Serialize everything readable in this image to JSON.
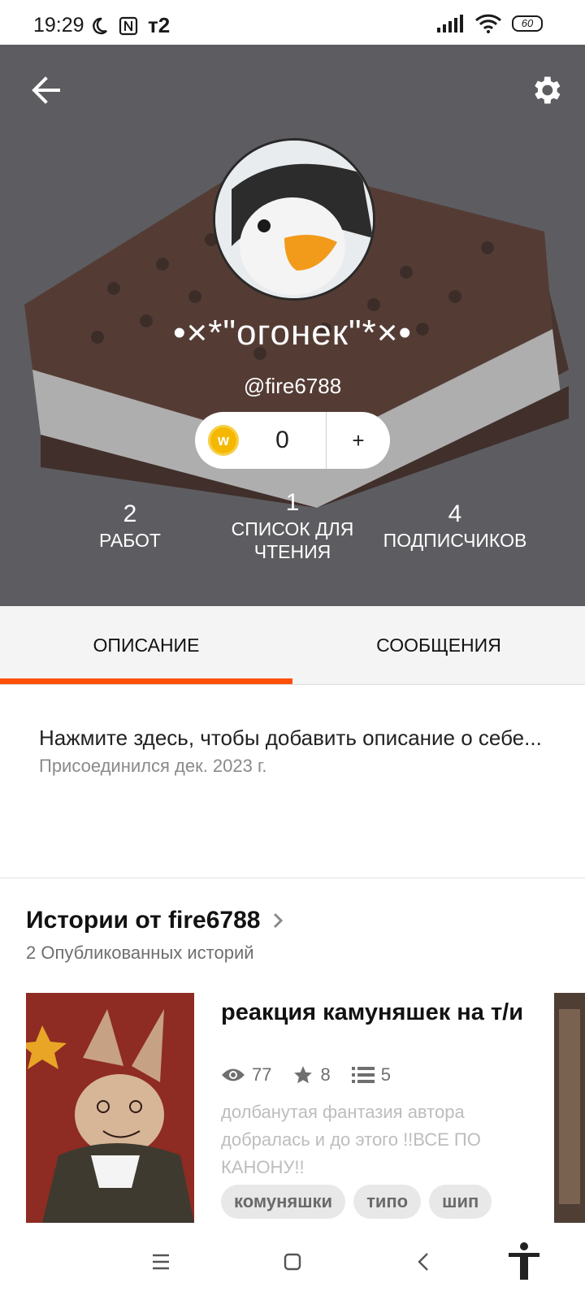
{
  "status_bar": {
    "time": "19:29",
    "carrier": "т2",
    "battery": "60",
    "icons": [
      "moon-icon",
      "nfc-icon",
      "signal-icon",
      "wifi-icon",
      "battery-icon"
    ]
  },
  "header": {
    "back_icon": "arrow-left-icon",
    "settings_icon": "gear-icon",
    "display_name": "•×*\"огонек\"*×•",
    "handle": "@fire6788",
    "coins": {
      "count": "0",
      "add_label": "+",
      "coin_letter": "w"
    },
    "stats": [
      {
        "value": "2",
        "label": "РАБОТ"
      },
      {
        "value": "1",
        "label": "СПИСОК ДЛЯ ЧТЕНИЯ"
      },
      {
        "value": "4",
        "label": "ПОДПИСЧИКОВ"
      }
    ]
  },
  "tabs": [
    {
      "label": "ОПИСАНИЕ",
      "active": true
    },
    {
      "label": "СООБЩЕНИЯ",
      "active": false
    }
  ],
  "about": {
    "description": "Нажмите здесь, чтобы добавить описание о себе...",
    "joined": "Присоединился дек. 2023 г."
  },
  "stories": {
    "title": "Истории от fire6788",
    "subtitle": "2 Опубликованных историй",
    "items": [
      {
        "title": "реакция камуняшек на т/и",
        "views": "77",
        "votes": "8",
        "parts": "5",
        "description": "долбанутая фантазия автора добралась и до этого !!ВСЕ ПО КАНОНУ!!",
        "tags": [
          "комуняшки",
          "типо",
          "шип"
        ]
      }
    ]
  },
  "nav_bar": {
    "icons": [
      "menu-icon",
      "home-square-icon",
      "back-chevron-icon",
      "accessibility-icon"
    ]
  }
}
